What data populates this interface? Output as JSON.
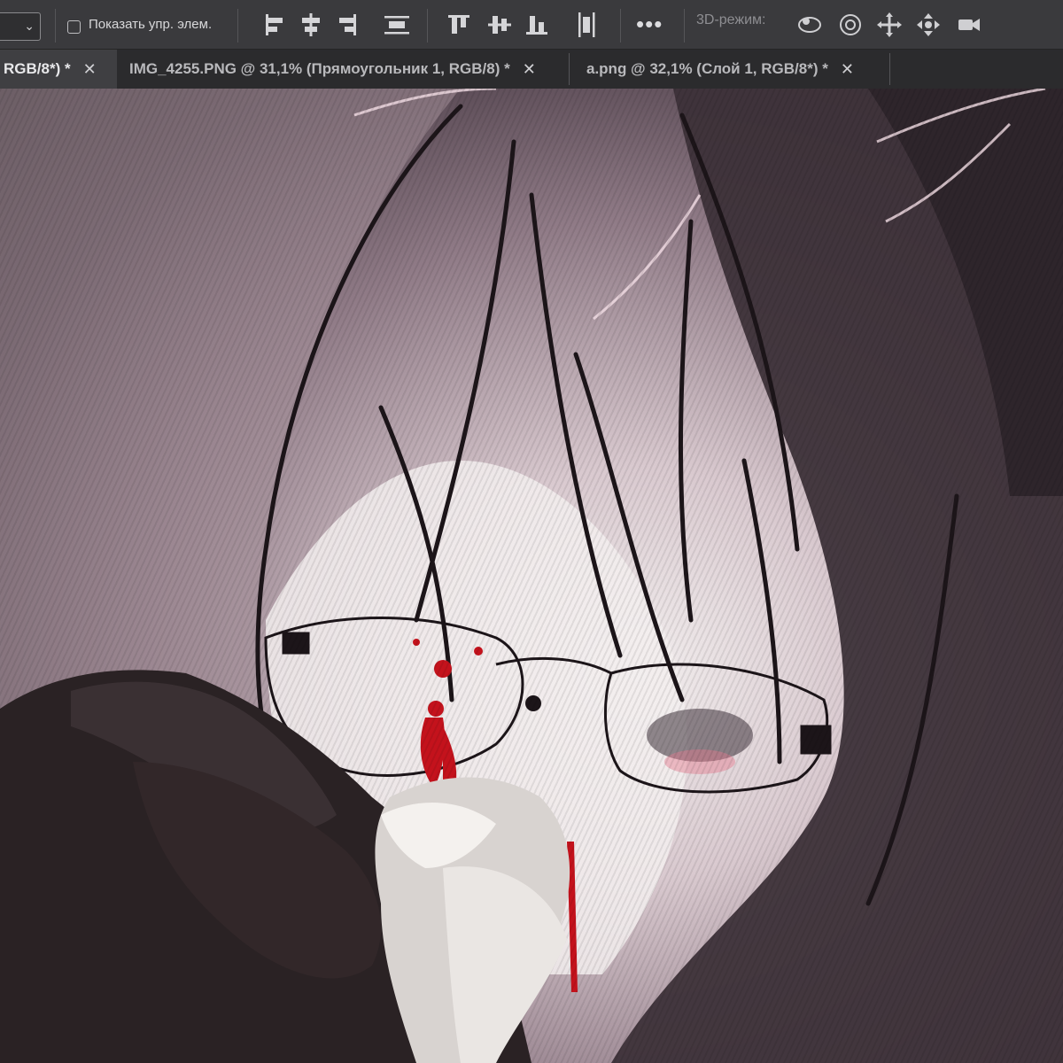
{
  "options_bar": {
    "show_controls_label": "Показать упр. элем.",
    "more_label": "•••",
    "mode_3d_label": "3D-режим:"
  },
  "tabs": [
    {
      "label": "RGB/8*) *",
      "active": true,
      "close": "✕"
    },
    {
      "label": "IMG_4255.PNG @ 31,1% (Прямоугольник 1, RGB/8) *",
      "active": false,
      "close": "✕"
    },
    {
      "label": "a.png @ 32,1% (Слой 1, RGB/8*) *",
      "active": false,
      "close": "✕"
    }
  ],
  "icons": {
    "align": [
      "align-left-edges-icon",
      "align-horizontal-centers-icon",
      "align-right-edges-icon",
      "distribute-horizontal-icon",
      "align-top-edges-icon",
      "align-vertical-centers-icon",
      "align-bottom-edges-icon",
      "distribute-vertical-icon"
    ],
    "mode3d": [
      "orbit-3d-icon",
      "roll-3d-icon",
      "pan-3d-icon",
      "slide-3d-icon",
      "scale-3d-camera-icon"
    ]
  },
  "colors": {
    "toolbar_bg": "#3a3a3d",
    "tabbar_bg": "#2b2b2d",
    "blood_red": "#c4121c"
  }
}
